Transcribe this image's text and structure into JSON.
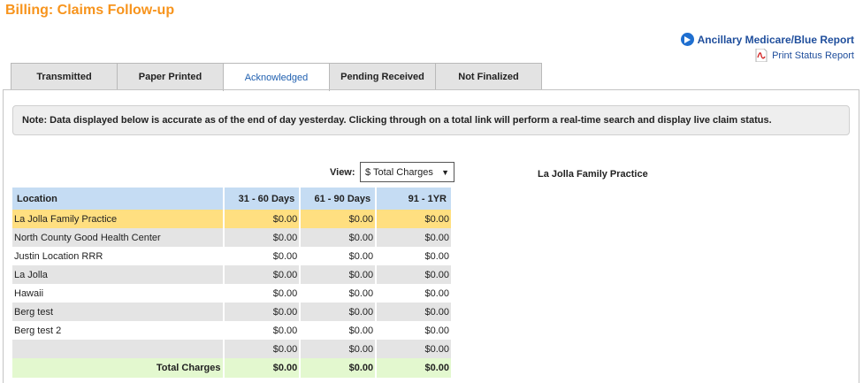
{
  "page": {
    "title": "Billing: Claims Follow-up"
  },
  "reports": {
    "main_link": "Ancillary Medicare/Blue Report",
    "print_link": "Print Status Report"
  },
  "tabs": [
    {
      "label": "Transmitted"
    },
    {
      "label": "Paper Printed"
    },
    {
      "label": "Acknowledged"
    },
    {
      "label": "Pending Received"
    },
    {
      "label": "Not Finalized"
    }
  ],
  "active_tab": "Acknowledged",
  "note": "Note: Data displayed below is accurate as of the end of day yesterday. Clicking through on a total link will perform a real-time search and display live claim status.",
  "view": {
    "label": "View:",
    "selected": "$ Total Charges"
  },
  "selected_location": "La Jolla Family Practice",
  "table": {
    "columns": [
      "Location",
      "31 - 60 Days",
      "61 - 90 Days",
      "91 - 1YR"
    ],
    "rows": [
      {
        "location": "La Jolla Family Practice",
        "d31_60": "$0.00",
        "d61_90": "$0.00",
        "d91_1yr": "$0.00"
      },
      {
        "location": "North County Good Health Center",
        "d31_60": "$0.00",
        "d61_90": "$0.00",
        "d91_1yr": "$0.00"
      },
      {
        "location": "Justin Location RRR",
        "d31_60": "$0.00",
        "d61_90": "$0.00",
        "d91_1yr": "$0.00"
      },
      {
        "location": "La Jolla",
        "d31_60": "$0.00",
        "d61_90": "$0.00",
        "d91_1yr": "$0.00"
      },
      {
        "location": "Hawaii",
        "d31_60": "$0.00",
        "d61_90": "$0.00",
        "d91_1yr": "$0.00"
      },
      {
        "location": "Berg test",
        "d31_60": "$0.00",
        "d61_90": "$0.00",
        "d91_1yr": "$0.00"
      },
      {
        "location": "Berg test 2",
        "d31_60": "$0.00",
        "d61_90": "$0.00",
        "d91_1yr": "$0.00"
      },
      {
        "location": "",
        "d31_60": "$0.00",
        "d61_90": "$0.00",
        "d91_1yr": "$0.00"
      }
    ],
    "totals": {
      "label": "Total Charges",
      "d31_60": "$0.00",
      "d61_90": "$0.00",
      "d91_1yr": "$0.00"
    }
  },
  "colors": {
    "title": "#f7941d",
    "link": "#1f4e9c",
    "header_bg": "#c5dcf3",
    "selected_row": "#ffdf80",
    "total_row": "#e3f8cf"
  },
  "icons": {
    "main_link": "play-circle-icon",
    "print_link": "pdf-icon"
  }
}
